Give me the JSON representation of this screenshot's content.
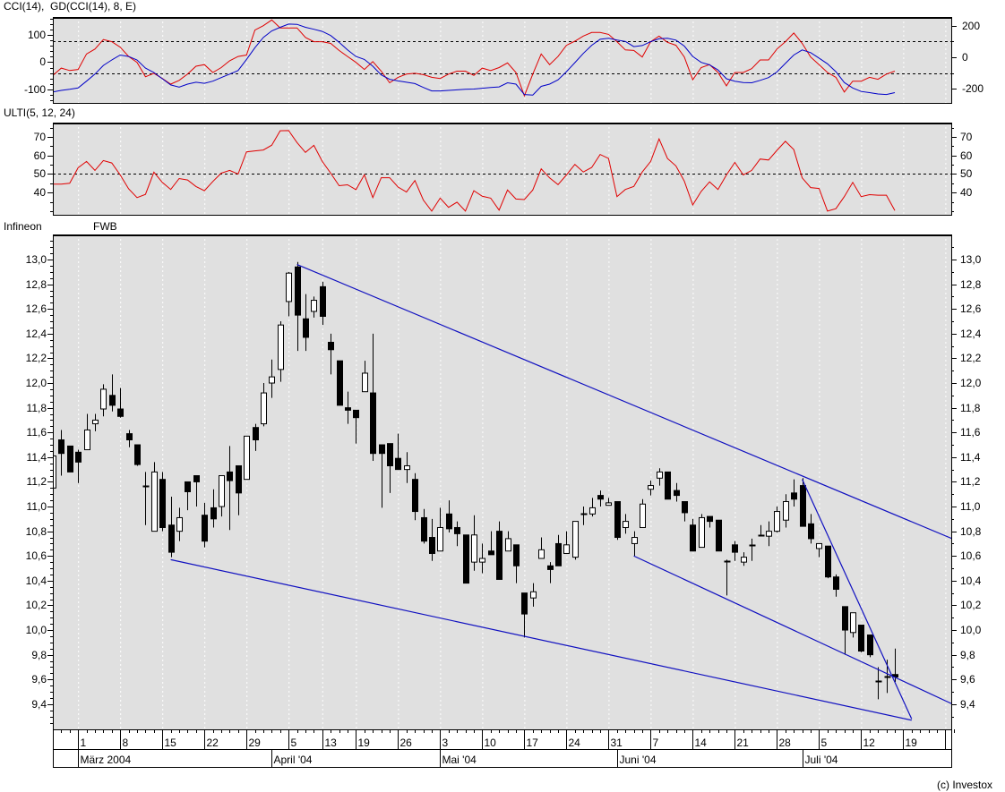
{
  "colors": {
    "panel_bg": "#e0e0e0",
    "cci": "#e00000",
    "gd": "#0000c8",
    "ulti": "#e00000",
    "trendline": "#1010c0",
    "grid": "#ffffff"
  },
  "labels": {
    "cci_title": "CCI(14),  GD(CCI(14), 8, E)",
    "ulti_title": "ULTI(5, 12, 24)",
    "symbol": "Infineon",
    "exchange": "FWB",
    "copyright": "(c) Investox"
  },
  "chart_data": [
    {
      "id": "cci",
      "type": "line",
      "title": "CCI(14),  GD(CCI(14), 8, E)",
      "ylim": [
        -150,
        166
      ],
      "left_ticks": [
        100,
        0,
        -100
      ],
      "right_axis": {
        "ticks": [
          200,
          0,
          -200
        ],
        "zero_in_left_units": 17.7,
        "right_units_per_left_unit": 1.718,
        "reference_lines": [
          100,
          -100
        ]
      },
      "series": [
        {
          "name": "CCI(14)",
          "color": "#e00000",
          "values": [
            -49,
            -22,
            -31,
            -27,
            30,
            48,
            83,
            75,
            55,
            21,
            -1,
            -54,
            -41,
            -60,
            -81,
            -67,
            -44,
            -15,
            -9,
            -38,
            -20,
            5,
            21,
            26,
            118,
            134,
            155,
            126,
            126,
            126,
            91,
            75,
            75,
            69,
            43,
            21,
            -1,
            -27,
            2,
            -33,
            -76,
            -56,
            -44,
            -41,
            -46,
            -56,
            -60,
            -44,
            -33,
            -33,
            -49,
            -22,
            -31,
            -20,
            -3,
            -38,
            -124,
            -44,
            30,
            -9,
            21,
            62,
            77,
            96,
            109,
            109,
            102,
            75,
            45,
            43,
            19,
            75,
            96,
            73,
            62,
            19,
            -65,
            -20,
            -9,
            -38,
            -87,
            -38,
            -38,
            -24,
            8,
            8,
            48,
            75,
            107,
            69,
            19,
            -9,
            -38,
            -56,
            -110,
            -70,
            -70,
            -56,
            -63,
            -44,
            -33
          ]
        },
        {
          "name": "GD(CCI(14), 8, E)",
          "color": "#0000c8",
          "values": [
            -110,
            -104,
            -100,
            -95,
            -70,
            -44,
            -12,
            8,
            26,
            21,
            8,
            -22,
            -38,
            -61,
            -84,
            -92,
            -81,
            -74,
            -78,
            -70,
            -57,
            -44,
            -31,
            10,
            53,
            91,
            115,
            128,
            140,
            139,
            128,
            121,
            113,
            98,
            73,
            45,
            21,
            10,
            -15,
            -47,
            -63,
            -69,
            -74,
            -79,
            -93,
            -106,
            -106,
            -104,
            -102,
            -100,
            -99,
            -96,
            -93,
            -91,
            -76,
            -81,
            -119,
            -121,
            -89,
            -81,
            -65,
            -35,
            -2,
            32,
            62,
            84,
            88,
            81,
            76,
            57,
            61,
            75,
            86,
            88,
            81,
            59,
            21,
            -1,
            -10,
            -29,
            -61,
            -70,
            -75,
            -76,
            -67,
            -57,
            -36,
            -5,
            26,
            45,
            35,
            15,
            -6,
            -35,
            -75,
            -95,
            -108,
            -112,
            -117,
            -119,
            -112
          ]
        }
      ]
    },
    {
      "id": "ulti",
      "type": "line",
      "title": "ULTI(5, 12, 24)",
      "ylim": [
        28,
        77.8
      ],
      "ticks": [
        70,
        60,
        50,
        40
      ],
      "reference_lines": [
        50
      ],
      "series": [
        {
          "name": "ULTI(5, 12, 24)",
          "color": "#e00000",
          "values": [
            44.6,
            44.6,
            45,
            53.4,
            56.8,
            52,
            57.3,
            56,
            49.5,
            42,
            37.3,
            39,
            51,
            45.5,
            41.7,
            47.6,
            46.8,
            43.3,
            41,
            46,
            50.5,
            52,
            50,
            62,
            62.5,
            63,
            65.6,
            73.4,
            73.5,
            67,
            61.7,
            65.5,
            56.8,
            50.5,
            43.7,
            44.2,
            41.6,
            49.6,
            37.3,
            48,
            48,
            43,
            40.3,
            46.5,
            36,
            30,
            37,
            32,
            34.8,
            30,
            41,
            38,
            37,
            30.5,
            41.4,
            36.5,
            36.2,
            41.4,
            52.8,
            47.9,
            44.3,
            49.5,
            55.2,
            51.1,
            53.6,
            60.6,
            58.4,
            37.8,
            41.7,
            43.3,
            51.1,
            56.8,
            69,
            58.4,
            54.4,
            46.2,
            33.3,
            40.6,
            45.8,
            41.7,
            49.5,
            56.3,
            49.5,
            52,
            58.1,
            57.6,
            62.8,
            67.7,
            63.2,
            47.9,
            42.7,
            42.2,
            30,
            31.3,
            37.8,
            45.5,
            37.8,
            38.9,
            38.6,
            38.6,
            30.3
          ]
        }
      ]
    },
    {
      "id": "price",
      "type": "candlestick",
      "title": "Infineon FWB",
      "ylim": [
        9.196,
        13.203
      ],
      "ticks": [
        13.0,
        12.8,
        12.6,
        12.4,
        12.2,
        12.0,
        11.8,
        11.6,
        11.4,
        11.2,
        11.0,
        10.8,
        10.6,
        10.4,
        10.2,
        10.0,
        9.8,
        9.6,
        9.4
      ],
      "ohlc_fields": [
        "open",
        "high",
        "low",
        "close"
      ],
      "candles": [
        [
          11.15,
          11.45,
          11.12,
          11.41
        ],
        [
          11.54,
          11.62,
          11.25,
          11.43
        ],
        [
          11.49,
          11.49,
          11.28,
          11.28
        ],
        [
          11.44,
          11.46,
          11.19,
          11.36
        ],
        [
          11.46,
          11.75,
          11.46,
          11.62
        ],
        [
          11.67,
          11.75,
          11.61,
          11.7
        ],
        [
          11.79,
          11.99,
          11.73,
          11.95
        ],
        [
          11.9,
          12.07,
          11.77,
          11.82
        ],
        [
          11.79,
          11.96,
          11.72,
          11.73
        ],
        [
          11.59,
          11.62,
          11.48,
          11.54
        ],
        [
          11.5,
          11.5,
          11.33,
          11.34
        ],
        [
          11.17,
          11.28,
          10.85,
          11.17
        ],
        [
          10.8,
          11.36,
          10.8,
          11.28
        ],
        [
          11.22,
          11.28,
          10.8,
          10.83
        ],
        [
          10.85,
          11.08,
          10.59,
          10.63
        ],
        [
          10.8,
          10.99,
          10.72,
          10.91
        ],
        [
          11.2,
          11.2,
          10.97,
          11.12
        ],
        [
          11.25,
          11.25,
          11.0,
          11.2
        ],
        [
          10.93,
          11.03,
          10.67,
          10.72
        ],
        [
          10.99,
          11.14,
          10.83,
          10.9
        ],
        [
          11.0,
          11.25,
          10.92,
          11.25
        ],
        [
          11.28,
          11.49,
          10.81,
          11.21
        ],
        [
          11.33,
          11.33,
          10.93,
          11.11
        ],
        [
          11.22,
          11.57,
          11.22,
          11.57
        ],
        [
          11.64,
          11.67,
          11.45,
          11.54
        ],
        [
          11.67,
          12.0,
          11.65,
          11.92
        ],
        [
          12.0,
          12.19,
          11.88,
          12.05
        ],
        [
          12.11,
          12.5,
          12.01,
          12.47
        ],
        [
          12.66,
          12.9,
          12.54,
          12.89
        ],
        [
          12.94,
          12.98,
          12.26,
          12.55
        ],
        [
          12.52,
          12.72,
          12.26,
          12.37
        ],
        [
          12.58,
          12.7,
          12.53,
          12.67
        ],
        [
          12.78,
          12.82,
          12.47,
          12.54
        ],
        [
          12.33,
          12.4,
          12.07,
          12.27
        ],
        [
          12.18,
          12.18,
          11.82,
          11.82
        ],
        [
          11.8,
          11.93,
          11.67,
          11.78
        ],
        [
          11.78,
          11.78,
          11.51,
          11.72
        ],
        [
          11.93,
          12.18,
          11.93,
          12.08
        ],
        [
          11.92,
          12.4,
          11.37,
          11.43
        ],
        [
          11.5,
          11.5,
          10.99,
          11.43
        ],
        [
          11.51,
          11.51,
          11.11,
          11.33
        ],
        [
          11.39,
          11.59,
          11.3,
          11.3
        ],
        [
          11.3,
          11.44,
          11.19,
          11.33
        ],
        [
          11.22,
          11.27,
          10.89,
          10.96
        ],
        [
          10.91,
          10.98,
          10.7,
          10.72
        ],
        [
          10.75,
          10.9,
          10.56,
          10.62
        ],
        [
          10.64,
          10.99,
          10.64,
          10.83
        ],
        [
          10.94,
          11.05,
          10.79,
          10.82
        ],
        [
          10.83,
          10.88,
          10.68,
          10.78
        ],
        [
          10.77,
          10.77,
          10.38,
          10.38
        ],
        [
          10.55,
          10.93,
          10.48,
          10.77
        ],
        [
          10.55,
          10.7,
          10.46,
          10.58
        ],
        [
          10.64,
          10.8,
          10.61,
          10.61
        ],
        [
          10.8,
          10.88,
          10.41,
          10.41
        ],
        [
          10.64,
          10.8,
          10.64,
          10.74
        ],
        [
          10.69,
          10.69,
          10.38,
          10.52
        ],
        [
          10.3,
          10.3,
          9.94,
          10.13
        ],
        [
          10.26,
          10.38,
          10.19,
          10.31
        ],
        [
          10.58,
          10.75,
          10.58,
          10.65
        ],
        [
          10.52,
          10.55,
          10.38,
          10.49
        ],
        [
          10.7,
          10.77,
          10.52,
          10.52
        ],
        [
          10.62,
          10.8,
          10.62,
          10.69
        ],
        [
          10.59,
          10.88,
          10.57,
          10.88
        ],
        [
          10.94,
          11.0,
          10.85,
          10.94
        ],
        [
          10.94,
          11.07,
          10.92,
          10.99
        ],
        [
          11.09,
          11.13,
          11.0,
          11.06
        ],
        [
          11.01,
          11.07,
          11.01,
          11.03
        ],
        [
          11.04,
          11.04,
          10.73,
          10.75
        ],
        [
          10.83,
          10.94,
          10.78,
          10.88
        ],
        [
          10.7,
          10.8,
          10.6,
          10.75
        ],
        [
          10.83,
          11.06,
          10.83,
          11.02
        ],
        [
          11.14,
          11.21,
          11.09,
          11.17
        ],
        [
          11.23,
          11.31,
          11.17,
          11.28
        ],
        [
          11.28,
          11.28,
          11.06,
          11.06
        ],
        [
          11.13,
          11.19,
          11.04,
          11.09
        ],
        [
          11.04,
          11.04,
          10.88,
          10.95
        ],
        [
          10.85,
          10.9,
          10.64,
          10.64
        ],
        [
          10.67,
          10.94,
          10.67,
          10.91
        ],
        [
          10.92,
          10.92,
          10.83,
          10.88
        ],
        [
          10.89,
          10.89,
          10.64,
          10.64
        ],
        [
          10.56,
          10.57,
          10.28,
          10.56
        ],
        [
          10.69,
          10.72,
          10.56,
          10.63
        ],
        [
          10.55,
          10.63,
          10.52,
          10.59
        ],
        [
          10.69,
          10.74,
          10.56,
          10.69
        ],
        [
          10.77,
          10.85,
          10.77,
          10.77
        ],
        [
          10.76,
          10.88,
          10.68,
          10.8
        ],
        [
          10.8,
          11.0,
          10.79,
          10.96
        ],
        [
          10.89,
          11.1,
          10.83,
          11.04
        ],
        [
          11.11,
          11.22,
          11.0,
          11.06
        ],
        [
          11.17,
          11.23,
          10.84,
          10.84
        ],
        [
          10.86,
          10.94,
          10.7,
          10.74
        ],
        [
          10.66,
          10.7,
          10.59,
          10.7
        ],
        [
          10.68,
          10.68,
          10.42,
          10.43
        ],
        [
          10.43,
          10.45,
          10.27,
          10.33
        ],
        [
          10.19,
          10.19,
          9.8,
          10.0
        ],
        [
          9.98,
          10.14,
          9.94,
          10.14
        ],
        [
          10.04,
          10.04,
          9.82,
          9.83
        ],
        [
          9.96,
          9.96,
          9.78,
          9.8
        ],
        [
          9.59,
          9.7,
          9.44,
          9.59
        ],
        [
          9.62,
          9.76,
          9.49,
          9.62
        ],
        [
          9.64,
          9.85,
          9.58,
          9.62
        ]
      ],
      "trendlines": [
        {
          "name": "upper-resistance",
          "from": [
            29,
            12.96
          ],
          "to": [
            107.5,
            10.72
          ]
        },
        {
          "name": "lower-support",
          "from": [
            14,
            10.57
          ],
          "to": [
            102,
            9.27
          ]
        },
        {
          "name": "inner-support",
          "from": [
            69,
            10.6
          ],
          "to": [
            107.5,
            9.38
          ]
        },
        {
          "name": "steep-resistance",
          "from": [
            89,
            11.22
          ],
          "to": [
            102,
            9.28
          ]
        }
      ]
    }
  ],
  "x_axis": {
    "range_in_bars": [
      0,
      107.5
    ],
    "week_labels": [
      [
        "1",
        3
      ],
      [
        "8",
        8
      ],
      [
        "15",
        13
      ],
      [
        "22",
        18
      ],
      [
        "29",
        23
      ],
      [
        "5",
        28
      ],
      [
        "13",
        32
      ],
      [
        "19",
        36
      ],
      [
        "26",
        41
      ],
      [
        "3",
        46
      ],
      [
        "10",
        51
      ],
      [
        "17",
        56
      ],
      [
        "24",
        61
      ],
      [
        "31",
        66
      ],
      [
        "7",
        71
      ],
      [
        "14",
        76
      ],
      [
        "21",
        81
      ],
      [
        "28",
        86
      ],
      [
        "5",
        91
      ],
      [
        "12",
        96
      ],
      [
        "19",
        101
      ],
      [
        "",
        106
      ]
    ],
    "month_labels": [
      [
        "März 2004",
        3
      ],
      [
        "April '04",
        26
      ],
      [
        "Mai '04",
        46
      ],
      [
        "Juni '04",
        67
      ],
      [
        "Juli '04",
        89
      ]
    ]
  }
}
